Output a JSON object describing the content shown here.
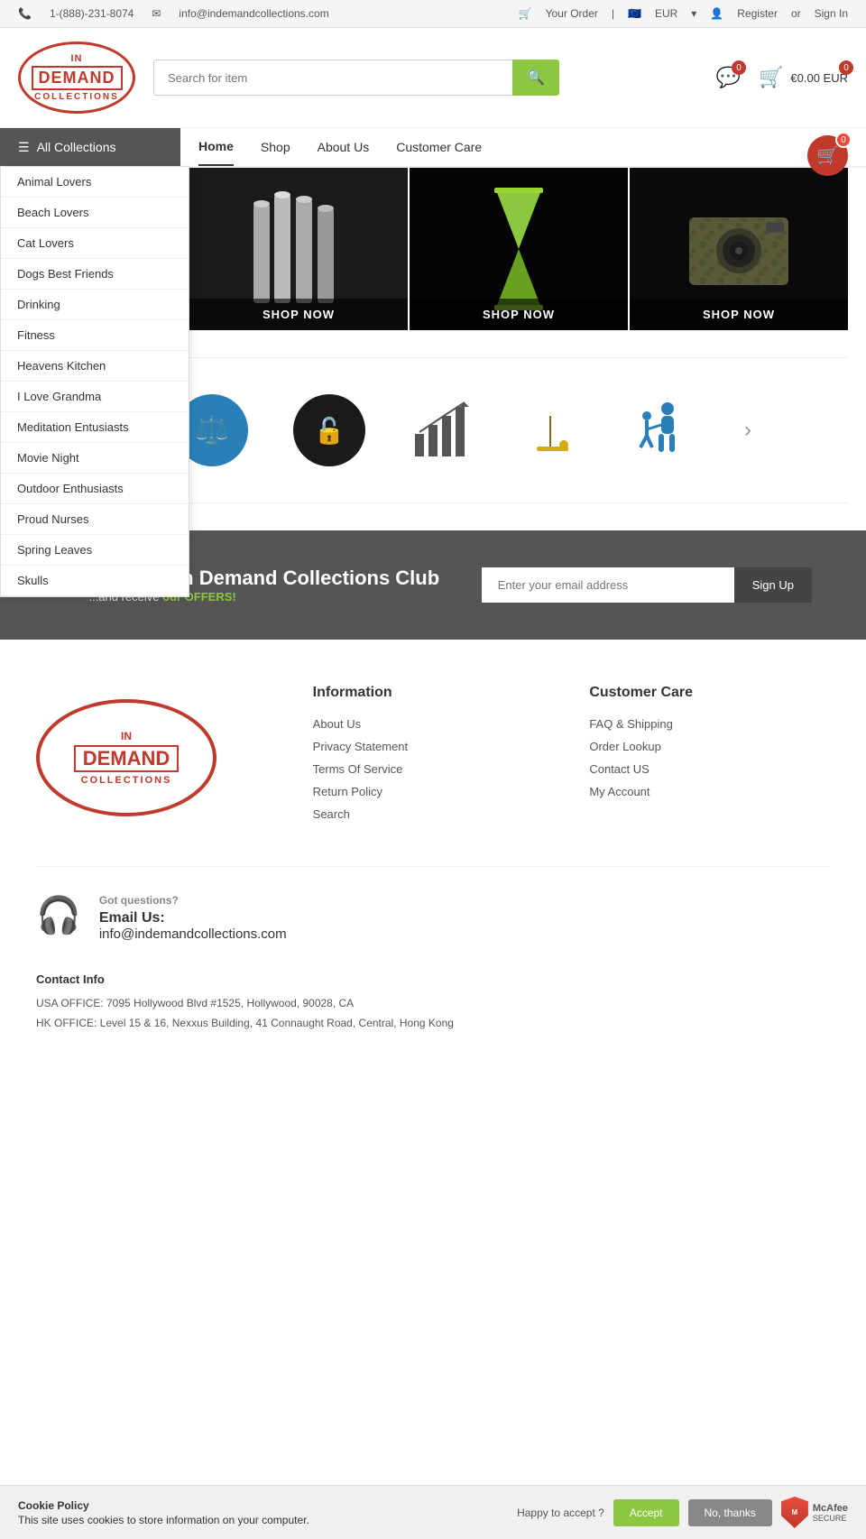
{
  "topbar": {
    "phone": "1-(888)-231-8074",
    "email": "info@indemandcollections.com",
    "order_label": "Your Order",
    "currency": "EUR",
    "register": "Register",
    "or": "or",
    "signin": "Sign In"
  },
  "header": {
    "logo_line1": "IN",
    "logo_line2": "DEMAND",
    "logo_line3": "COLLECTIONS",
    "search_placeholder": "Search for item",
    "wishlist_count": "0",
    "cart_count": "0",
    "cart_total": "€0.00 EUR",
    "floating_cart_badge": "0"
  },
  "nav": {
    "collections_label": "All Collections",
    "links": [
      {
        "label": "Home",
        "active": true
      },
      {
        "label": "Shop",
        "active": false
      },
      {
        "label": "About Us",
        "active": false
      },
      {
        "label": "Customer Care",
        "active": false
      }
    ]
  },
  "collections_menu": {
    "items": [
      "Animal Lovers",
      "Beach Lovers",
      "Cat Lovers",
      "Dogs Best Friends",
      "Drinking",
      "Fitness",
      "Heavens Kitchen",
      "I Love Grandma",
      "Meditation Entusiasts",
      "Movie Night",
      "Outdoor Enthusiasts",
      "Proud Nurses",
      "Spring Leaves",
      "Skulls"
    ]
  },
  "products": [
    {
      "shop_now": "SHOP NOW",
      "bg": "#1a1a1a",
      "type": "silver"
    },
    {
      "shop_now": "SHOP NOW",
      "bg": "#0a0a0a",
      "type": "hourglass"
    },
    {
      "shop_now": "SHOP NOW",
      "bg": "#111",
      "type": "camera"
    }
  ],
  "icons_row": [
    {
      "name": "scale-icon",
      "color": "#2980b9",
      "bg": "#2980b9",
      "symbol": "⚖"
    },
    {
      "name": "lock-icon",
      "color": "#fff",
      "bg": "#1a1a1a",
      "symbol": "🔓"
    },
    {
      "name": "growth-icon",
      "color": "#555",
      "bg": "none",
      "symbol": "📈"
    },
    {
      "name": "beach-icon",
      "color": "#d4ac0d",
      "bg": "none",
      "symbol": "🏖"
    },
    {
      "name": "person-icon",
      "color": "#2980b9",
      "bg": "none",
      "symbol": "🧑‍🤝‍🧑"
    }
  ],
  "newsletter": {
    "title": "Join The In Demand Collections Club",
    "subtitle_before": "...and receive ",
    "subtitle_highlight": "our OFFERS!",
    "email_placeholder": "Enter your email address",
    "button_label": "Sign Up"
  },
  "footer": {
    "logo_line1": "IN",
    "logo_line2": "DEMAND",
    "logo_line3": "COLLECTIONS",
    "information": {
      "heading": "Information",
      "links": [
        "About Us",
        "Privacy Statement",
        "Terms Of Service",
        "Return Policy",
        "Search"
      ]
    },
    "customer_care": {
      "heading": "Customer Care",
      "links": [
        "FAQ & Shipping",
        "Order Lookup",
        "Contact US",
        "My Account"
      ]
    },
    "contact": {
      "got_questions": "Got questions?",
      "email_label": "Email Us:",
      "email": "info@indemandcollections.com"
    },
    "contact_info": {
      "heading": "Contact Info",
      "address1": "USA OFFICE: 7095 Hollywood Blvd #1525, Hollywood, 90028, CA",
      "address2": "HK OFFICE: Level 15 & 16, Nexxus Building, 41 Connaught Road, Central, Hong Kong"
    }
  },
  "cookie": {
    "title": "Cookie Policy",
    "description": "This site uses cookies to store information on your computer.",
    "happy_label": "Happy to accept ?",
    "accept_label": "Accept",
    "decline_label": "No, thanks",
    "mcafee_label": "McAfee",
    "mcafee_sub": "SECURE"
  }
}
